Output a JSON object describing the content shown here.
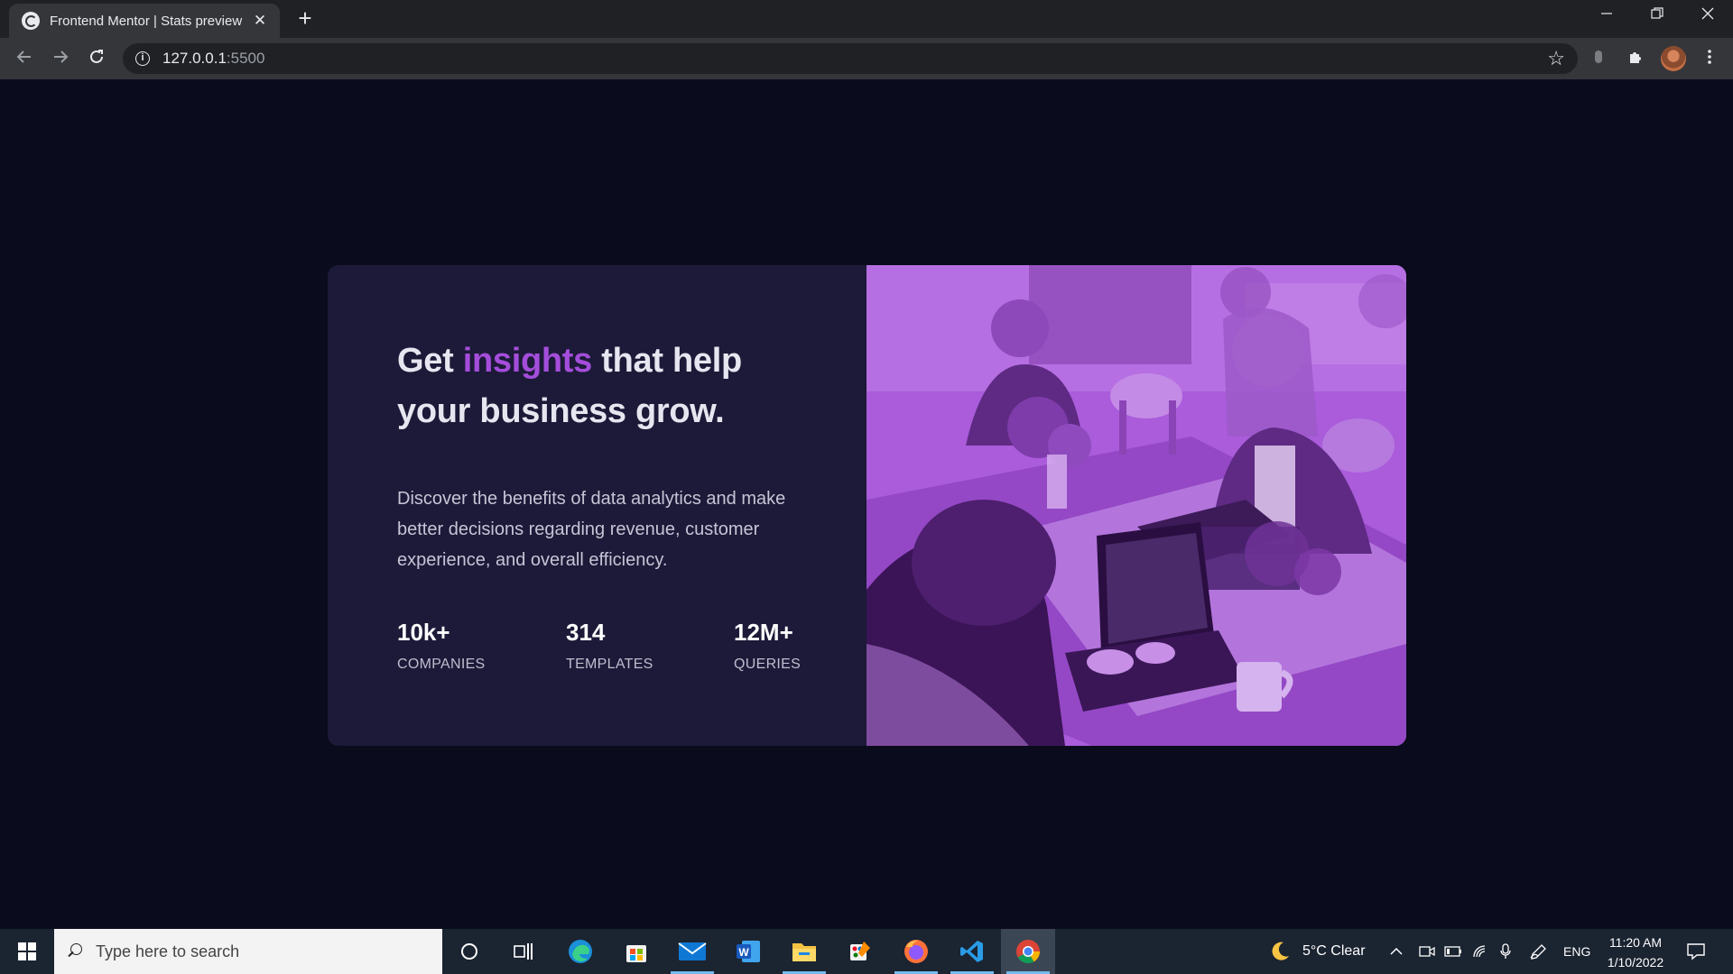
{
  "browser": {
    "tab_title": "Frontend Mentor | Stats preview",
    "url_host": "127.0.0.1",
    "url_port": ":5500",
    "new_tab_glyph": "+",
    "close_glyph": "✕"
  },
  "card": {
    "headline_pre": "Get ",
    "headline_accent": "insights",
    "headline_post": " that help your business grow.",
    "description": "Discover the benefits of data analytics and make better decisions regarding revenue, customer experience, and overall efficiency.",
    "stats": [
      {
        "value": "10k+",
        "label": "COMPANIES"
      },
      {
        "value": "314",
        "label": "TEMPLATES"
      },
      {
        "value": "12M+",
        "label": "QUERIES"
      }
    ],
    "colors": {
      "background": "#1c1a38",
      "accent": "#a44ddb",
      "image_tint": "#aa5cdb",
      "page": "#0a0c1d"
    }
  },
  "taskbar": {
    "search_placeholder": "Type here to search",
    "weather": "5°C  Clear",
    "language": "ENG",
    "time": "11:20 AM",
    "date": "1/10/2022",
    "apps": [
      "cortana-icon",
      "task-view-icon",
      "edge-icon",
      "store-icon",
      "mail-icon",
      "word-icon",
      "file-explorer-icon",
      "paint-icon",
      "firefox-icon",
      "vscode-icon",
      "chrome-icon"
    ]
  }
}
